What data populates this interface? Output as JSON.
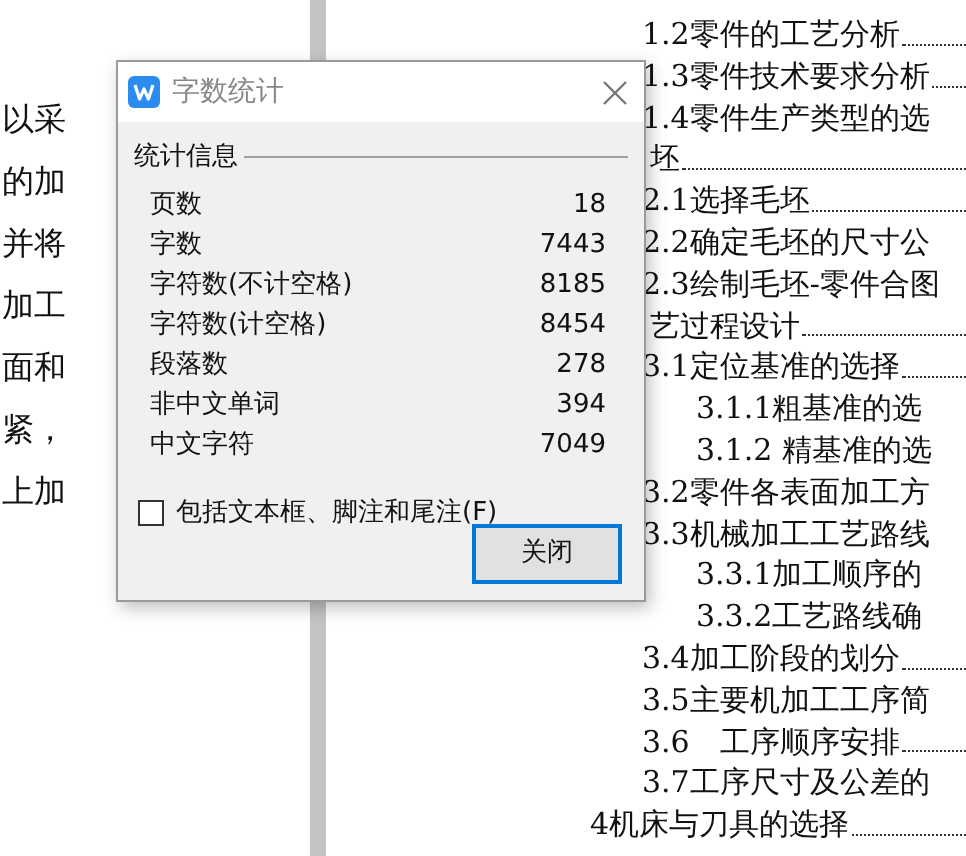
{
  "left_page": {
    "lines": [
      "以采",
      "的加",
      "并将",
      "加工",
      "面和",
      "紧，",
      "上加"
    ]
  },
  "toc": [
    {
      "children": [
        {
          "text": "1.2零件的工艺分析",
          "leader": true
        },
        {
          "text": "1.3零件技术要求分析",
          "leader": true
        },
        {
          "text": "1.4零件生产类型的选",
          "leader": false
        }
      ]
    },
    {
      "text": "坯",
      "kind": "cut",
      "leader": true,
      "children": [
        {
          "text": "2.1选择毛坯",
          "leader": true
        },
        {
          "text": "2.2确定毛坯的尺寸公",
          "leader": false
        },
        {
          "text": "2.3绘制毛坯-零件合图",
          "leader": false
        }
      ]
    },
    {
      "text": "艺过程设计",
      "kind": "cut",
      "leader": true,
      "children": [
        {
          "text": "3.1定位基准的选择",
          "leader": true,
          "children": [
            {
              "text": "3.1.1粗基准的选",
              "leader": false
            },
            {
              "text": "3.1.2 精基准的选",
              "leader": false
            }
          ]
        },
        {
          "text": "3.2零件各表面加工方",
          "leader": false
        },
        {
          "text": "3.3机械加工工艺路线",
          "leader": false,
          "children": [
            {
              "text": "3.3.1加工顺序的",
              "leader": false
            },
            {
              "text": "3.3.2工艺路线确",
              "leader": false
            }
          ]
        },
        {
          "text": "3.4加工阶段的划分",
          "leader": true
        },
        {
          "text": "3.5主要机加工工序简",
          "leader": false
        },
        {
          "text": "3.6　工序顺序安排",
          "leader": true
        },
        {
          "text": "3.7工序尺寸及公差的",
          "leader": false
        }
      ]
    },
    {
      "text": "4机床与刀具的选择",
      "kind": "full",
      "leader": true
    }
  ],
  "dialog": {
    "title": "字数统计",
    "group_label": "统计信息",
    "stats": [
      {
        "label": "页数",
        "value": "18"
      },
      {
        "label": "字数",
        "value": "7443"
      },
      {
        "label": "字符数(不计空格)",
        "value": "8185"
      },
      {
        "label": "字符数(计空格)",
        "value": "8454"
      },
      {
        "label": "段落数",
        "value": "278"
      },
      {
        "label": "非中文单词",
        "value": "394"
      },
      {
        "label": "中文字符",
        "value": "7049"
      }
    ],
    "checkbox": {
      "label": "包括文本框、脚注和尾注(F)",
      "checked": false
    },
    "button": "关闭"
  }
}
